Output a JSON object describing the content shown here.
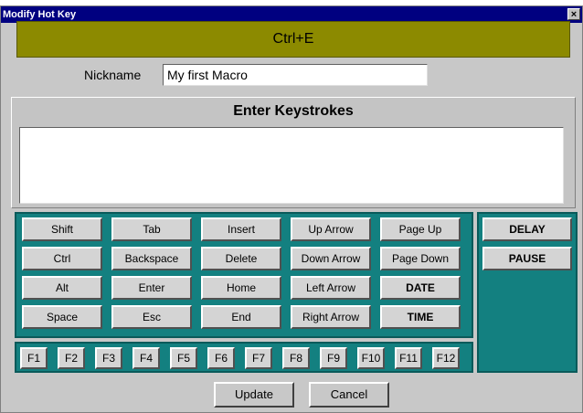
{
  "window": {
    "title": "Modify Hot Key",
    "close_glyph": "×"
  },
  "hotkey": {
    "value": "Ctrl+E"
  },
  "nickname": {
    "label": "Nickname",
    "value": "My first Macro"
  },
  "keystrokes": {
    "title": "Enter Keystrokes",
    "value": ""
  },
  "keypad": {
    "columns": [
      [
        "Shift",
        "Ctrl",
        "Alt",
        "Space"
      ],
      [
        "Tab",
        "Backspace",
        "Enter",
        "Esc"
      ],
      [
        "Insert",
        "Delete",
        "Home",
        "End"
      ],
      [
        "Up Arrow",
        "Down Arrow",
        "Left Arrow",
        "Right Arrow"
      ],
      [
        "Page Up",
        "Page Down",
        "DATE",
        "TIME"
      ]
    ]
  },
  "side": {
    "delay": "DELAY",
    "pause": "PAUSE"
  },
  "fkeys": [
    "F1",
    "F2",
    "F3",
    "F4",
    "F5",
    "F6",
    "F7",
    "F8",
    "F9",
    "F10",
    "F11",
    "F12"
  ],
  "buttons": {
    "update": "Update",
    "cancel": "Cancel"
  },
  "colors": {
    "hotkey_bg": "#8c8a00",
    "keypad_bg": "#138080",
    "titlebar": "#000080"
  }
}
